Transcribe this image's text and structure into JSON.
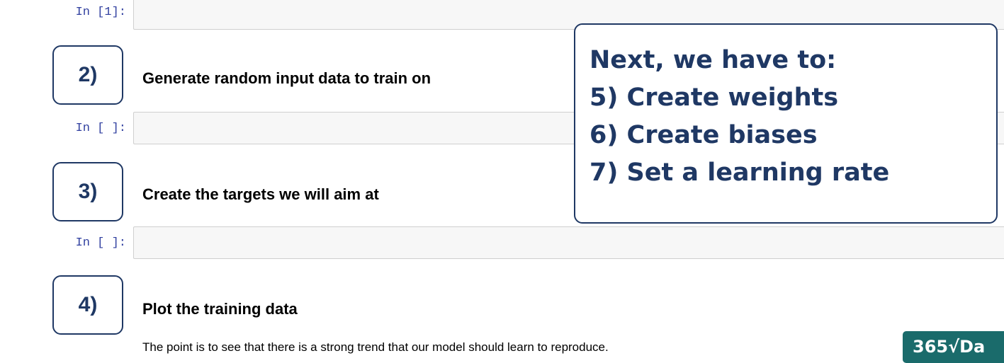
{
  "cells": [
    {
      "prompt": "In [1]:"
    },
    {
      "prompt": "In [ ]:"
    },
    {
      "prompt": "In [ ]:"
    }
  ],
  "steps": [
    {
      "number": "2)",
      "heading": "Generate random input data to train on"
    },
    {
      "number": "3)",
      "heading": "Create the targets we will aim at"
    },
    {
      "number": "4)",
      "heading": "Plot the training data"
    }
  ],
  "step4_paragraph": "The point is to see that there is a strong trend that our model should learn to reproduce.",
  "callout": {
    "title": "Next, we have to:",
    "items": [
      "5) Create weights",
      "6) Create biases",
      "7) Set a learning rate"
    ]
  },
  "logo": {
    "text": "365√Da"
  },
  "colors": {
    "accent": "#1f3864",
    "prompt": "#303f9f",
    "logo_bg": "#1a6b6b"
  }
}
